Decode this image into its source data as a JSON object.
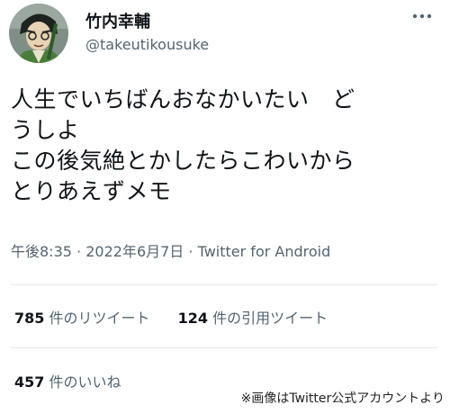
{
  "author": {
    "display_name": "竹内幸輔",
    "handle": "@takeutikousuke",
    "avatar_icon": "avatar-illustration"
  },
  "tweet": {
    "lines": [
      "人生でいちばんおなかいたい　ど",
      "うしよ",
      "この後気絶とかしたらこわいから",
      "とりあえずメモ"
    ],
    "time": "午後8:35",
    "separator": "·",
    "date": "2022年6月7日",
    "client": "Twitter for Android"
  },
  "stats": {
    "retweets": {
      "count": "785",
      "label": "件のリツイート"
    },
    "quotes": {
      "count": "124",
      "label": "件の引用ツイート"
    },
    "likes": {
      "count": "457",
      "label": "件のいいね"
    }
  },
  "caption": "※画像はTwitter公式アカウントより",
  "colors": {
    "text_primary": "#0f1419",
    "text_secondary": "#536471",
    "divider": "#e3e7ea"
  },
  "icons": {
    "more": "more-horizontal-icon"
  }
}
